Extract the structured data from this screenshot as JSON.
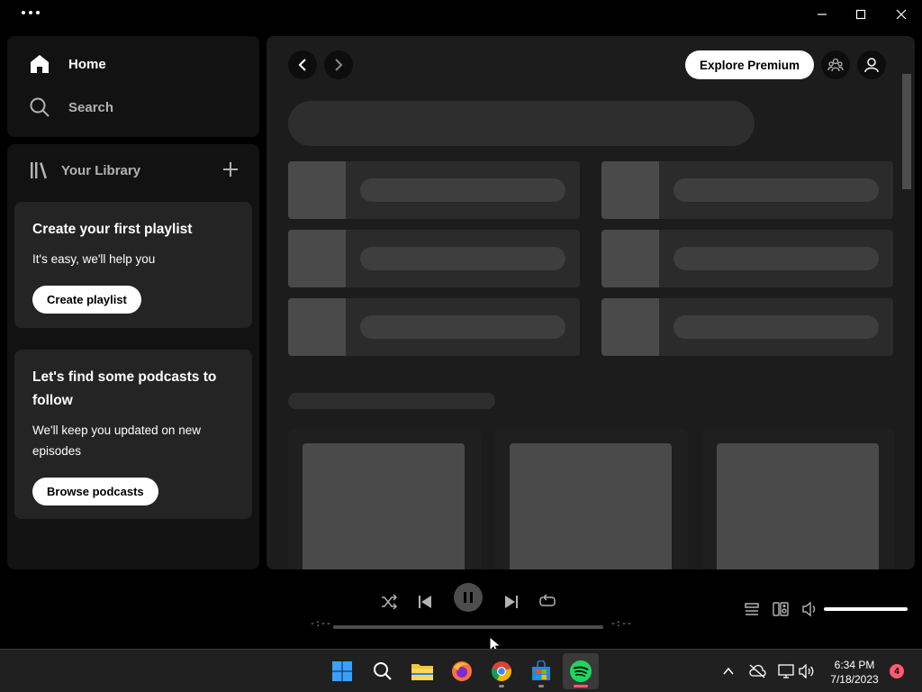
{
  "sidebar": {
    "nav": [
      {
        "label": "Home",
        "icon": "home-icon"
      },
      {
        "label": "Search",
        "icon": "search-icon"
      }
    ],
    "library": {
      "label": "Your Library",
      "cards": [
        {
          "title": "Create your first playlist",
          "text": "It's easy, we'll help you",
          "button": "Create playlist"
        },
        {
          "title": "Let's find some podcasts to follow",
          "text": "We'll keep you updated on new episodes",
          "button": "Browse podcasts"
        }
      ]
    }
  },
  "header": {
    "premium_label": "Explore Premium"
  },
  "player": {
    "elapsed": "-:--",
    "remaining": "-:--",
    "volume_level": 1.0,
    "progress": 0
  },
  "taskbar": {
    "apps": [
      "start-icon",
      "search-icon",
      "file-explorer-icon",
      "firefox-icon",
      "chrome-icon",
      "microsoft-store-icon",
      "spotify-icon"
    ],
    "time": "6:34 PM",
    "date": "7/18/2023",
    "notifications": "4"
  },
  "colors": {
    "background": "#000000",
    "panel": "#121212",
    "card": "#242424",
    "spotify_green": "#1ed760",
    "notification": "#ff5a6e"
  }
}
